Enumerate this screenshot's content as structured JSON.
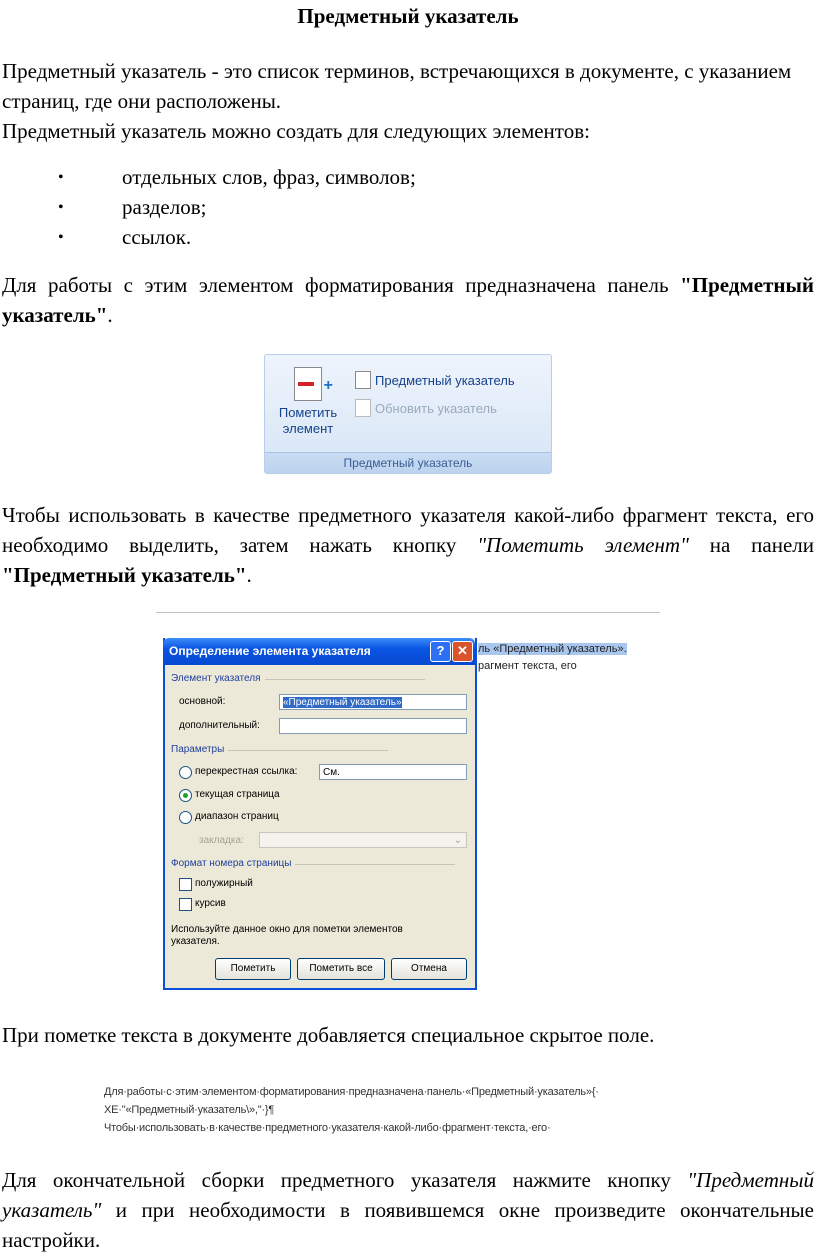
{
  "title": "Предметный указатель",
  "intro": {
    "line1": "Предметный указатель - это список терминов, встречающихся в документе, с указанием страниц, где они расположены.",
    "line2": "Предметный указатель можно создать для следующих элементов:"
  },
  "bullets": [
    "отдельных слов, фраз, символов;",
    "разделов;",
    "ссылок."
  ],
  "panel_para": {
    "text": "Для работы с этим элементом форматирования предназначена панель ",
    "bold": "\"Предметный указатель\"",
    "end": "."
  },
  "ribbon": {
    "big_button": "Пометить элемент",
    "item1": "Предметный указатель",
    "item2": "Обновить указатель",
    "group_label": "Предметный указатель"
  },
  "mark_para": {
    "text": "Чтобы использовать в качестве предметного указателя какой-либо фрагмент текста, его необходимо выделить, затем нажать кнопку ",
    "italic": "\"Пометить элемент\"",
    "mid": " на панели ",
    "bold": "\"Предметный указатель\"",
    "end": "."
  },
  "dialog": {
    "bg_text1": "ль «Предметный указатель».",
    "bg_text2": "рагмент текста, его",
    "title": "Определение элемента указателя",
    "group_element": "Элемент указателя",
    "main_label": "основной:",
    "main_value": "«Предметный указатель»",
    "sub_label": "дополнительный:",
    "sub_value": "",
    "group_params": "Параметры",
    "cross_ref_label": "перекрестная ссылка:",
    "cross_ref_value": "См.",
    "current_page_label": "текущая страница",
    "page_range_label": "диапазон страниц",
    "bookmark_label": "закладка:",
    "group_format": "Формат номера страницы",
    "bold_label": "полужирный",
    "italic_label": "курсив",
    "note": "Используйте данное окно для пометки элементов указателя.",
    "btn_mark": "Пометить",
    "btn_mark_all": "Пометить все",
    "btn_cancel": "Отмена",
    "help_glyph": "?",
    "close_glyph": "✕"
  },
  "hidden_para": "При пометке текста в документе добавляется специальное скрытое поле.",
  "snippet": {
    "line1": "Для·работы·с·этим·элементом·форматирования·предназначена·панель·«Предметный·указатель»{·",
    "line2": "XE·\"«Предметный·указатель\\»,\"·}¶",
    "line3": "Чтобы·использовать·в·качестве·предметного·указателя·какой-либо·фрагмент·текста,·его·"
  },
  "final_para": {
    "text1": "Для окончательной сборки предметного указателя нажмите кнопку ",
    "italic": "\"Предметный указатель\"",
    "text2": " и при необходимости в появившемся окне произведите окончательные настройки."
  }
}
